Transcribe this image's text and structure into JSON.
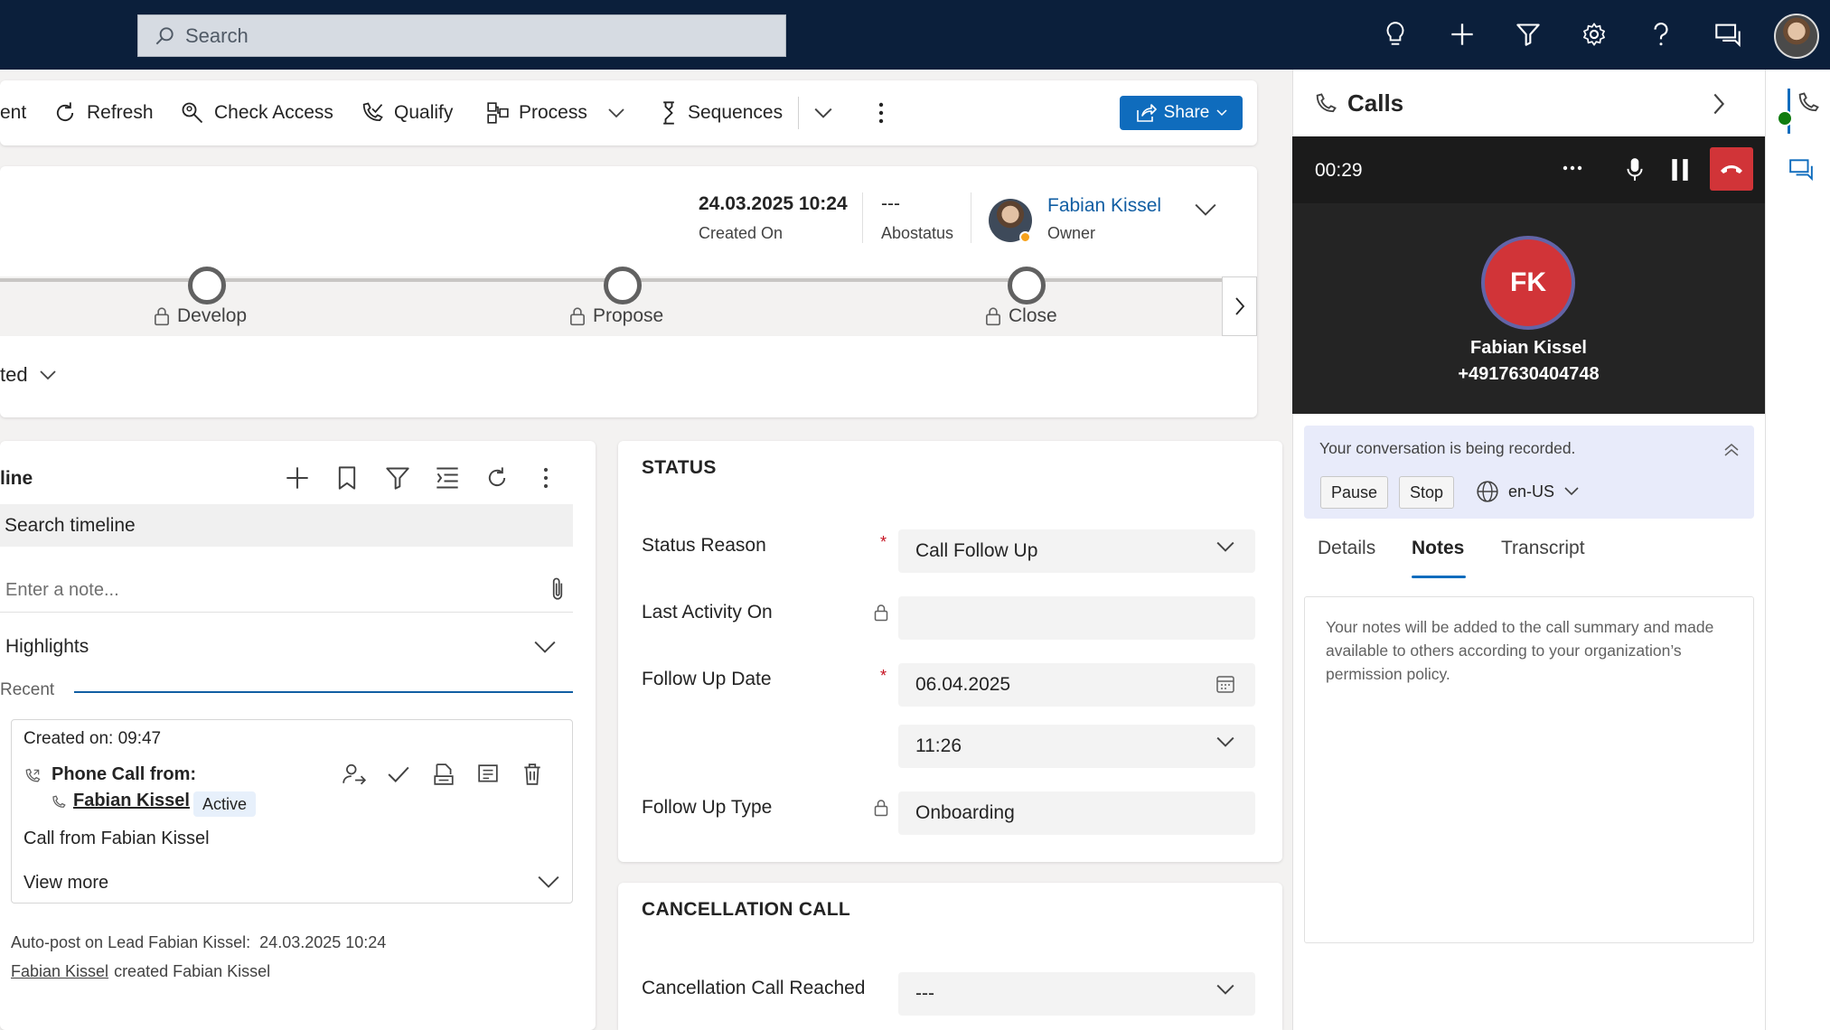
{
  "topbar": {
    "search_placeholder": "Search",
    "icons": [
      "lightbulb-icon",
      "plus-icon",
      "filter-icon",
      "gear-icon",
      "help-icon",
      "chat-icon"
    ]
  },
  "commandbar": {
    "partial_label": "ent",
    "refresh": "Refresh",
    "check_access": "Check Access",
    "qualify": "Qualify",
    "process": "Process",
    "sequences": "Sequences",
    "share": "Share"
  },
  "header": {
    "created_on_value": "24.03.2025 10:24",
    "created_on_label": "Created On",
    "abostatus_value": "---",
    "abostatus_label": "Abostatus",
    "owner_name": "Fabian Kissel",
    "owner_label": "Owner",
    "stages": [
      "Develop",
      "Propose",
      "Close"
    ],
    "partial_status": "ted"
  },
  "timeline": {
    "title_partial": "line",
    "search_placeholder": "Search timeline",
    "note_placeholder": "Enter a note...",
    "highlights": "Highlights",
    "recent": "Recent",
    "post": {
      "created": "Created on: 09:47",
      "heading": "Phone Call from:",
      "contact": "Fabian Kissel",
      "badge": "Active",
      "body": "Call from Fabian Kissel",
      "view_more": "View more"
    },
    "autopost": {
      "line1_prefix": "Auto-post on Lead Fabian Kissel:",
      "line1_time": "24.03.2025 10:24",
      "line2_link": "Fabian Kissel",
      "line2_text": "created Fabian Kissel"
    }
  },
  "status": {
    "title": "STATUS",
    "status_reason_label": "Status Reason",
    "status_reason_value": "Call Follow Up",
    "last_activity_label": "Last Activity On",
    "last_activity_value": "",
    "follow_up_date_label": "Follow Up Date",
    "follow_up_date_value": "06.04.2025",
    "follow_up_time_value": "11:26",
    "follow_up_type_label": "Follow Up Type",
    "follow_up_type_value": "Onboarding",
    "required_mark": "*"
  },
  "cancellation": {
    "title": "CANCELLATION CALL",
    "reached_label": "Cancellation Call Reached",
    "reached_value": "---"
  },
  "calls": {
    "title": "Calls",
    "timer": "00:29",
    "avatar_initials": "FK",
    "caller_name": "Fabian Kissel",
    "caller_number": "+4917630404748",
    "recording_text": "Your conversation is being recorded.",
    "pause": "Pause",
    "stop": "Stop",
    "language": "en-US",
    "tabs": [
      "Details",
      "Notes",
      "Transcript"
    ],
    "active_tab": "Notes",
    "notes_hint": "Your notes will be added to the call summary and made available to others according to your organization’s permission policy."
  },
  "colors": {
    "topbar": "#0b1f3b",
    "accent": "#0f6cbd",
    "hangup": "#d13438",
    "call_dark": "#242424",
    "recording_bg": "#e8ebfa"
  }
}
